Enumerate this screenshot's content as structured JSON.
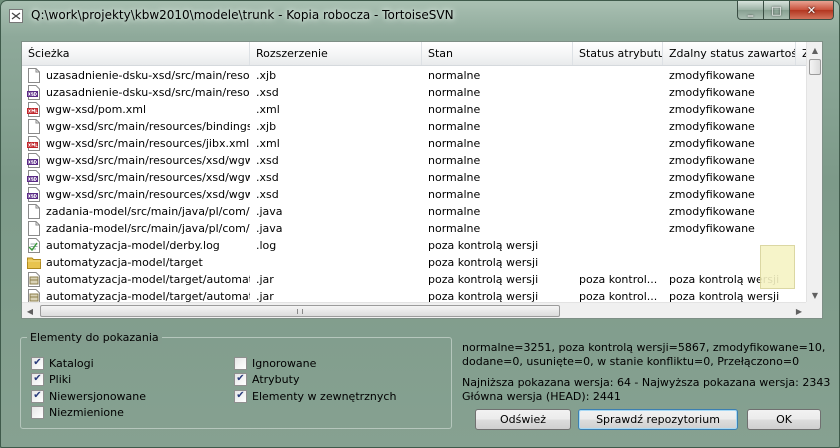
{
  "window": {
    "title": "Q:\\work\\projekty\\kbw2010\\modele\\trunk - Kopia robocza - TortoiseSVN",
    "minimize_glyph": "_",
    "maximize_glyph": "□",
    "close_glyph": "✕"
  },
  "list": {
    "columns": [
      "Ścieżka",
      "Rozszerzenie",
      "Stan",
      "Status atrybutu",
      "Zdalny status zawartości",
      "Z"
    ],
    "rows": [
      {
        "path": "uzasadnienie-dsku-xsd/src/main/reso...",
        "ext": ".xjb",
        "status": "normalne",
        "prop": "",
        "remote": "zmodyfikowane",
        "icon": "file-icon"
      },
      {
        "path": "uzasadnienie-dsku-xsd/src/main/reso...",
        "ext": ".xsd",
        "status": "normalne",
        "prop": "",
        "remote": "zmodyfikowane",
        "icon": "xsd-file-icon"
      },
      {
        "path": "wgw-xsd/pom.xml",
        "ext": ".xml",
        "status": "normalne",
        "prop": "",
        "remote": "zmodyfikowane",
        "icon": "xml-file-icon"
      },
      {
        "path": "wgw-xsd/src/main/resources/bindings.xjb",
        "ext": ".xjb",
        "status": "normalne",
        "prop": "",
        "remote": "zmodyfikowane",
        "icon": "file-icon"
      },
      {
        "path": "wgw-xsd/src/main/resources/jibx.xml",
        "ext": ".xml",
        "status": "normalne",
        "prop": "",
        "remote": "zmodyfikowane",
        "icon": "xml-file-icon"
      },
      {
        "path": "wgw-xsd/src/main/resources/xsd/wgw-...",
        "ext": ".xsd",
        "status": "normalne",
        "prop": "",
        "remote": "zmodyfikowane",
        "icon": "xsd-file-icon"
      },
      {
        "path": "wgw-xsd/src/main/resources/xsd/wgw-...",
        "ext": ".xsd",
        "status": "normalne",
        "prop": "",
        "remote": "zmodyfikowane",
        "icon": "xsd-file-icon"
      },
      {
        "path": "wgw-xsd/src/main/resources/xsd/wgw...",
        "ext": ".xsd",
        "status": "normalne",
        "prop": "",
        "remote": "zmodyfikowane",
        "icon": "xsd-file-icon"
      },
      {
        "path": "zadania-model/src/main/java/pl/com/pi...",
        "ext": ".java",
        "status": "normalne",
        "prop": "",
        "remote": "zmodyfikowane",
        "icon": "file-icon"
      },
      {
        "path": "zadania-model/src/main/java/pl/com/pi...",
        "ext": ".java",
        "status": "normalne",
        "prop": "",
        "remote": "zmodyfikowane",
        "icon": "file-icon"
      },
      {
        "path": "automatyzacja-model/derby.log",
        "ext": ".log",
        "status": "poza kontrolą wersji",
        "prop": "",
        "remote": "",
        "icon": "text-file-icon"
      },
      {
        "path": "automatyzacja-model/target",
        "ext": "",
        "status": "poza kontrolą wersji",
        "prop": "",
        "remote": "",
        "icon": "folder-icon"
      },
      {
        "path": "automatyzacja-model/target/automaty...",
        "ext": ".jar",
        "status": "poza kontrolą wersji",
        "prop": "poza kontrol...",
        "remote": "poza kontrolą wersji",
        "icon": "jar-file-icon"
      },
      {
        "path": "automatyzacja-model/target/automaty...",
        "ext": ".jar",
        "status": "poza kontrolą wersji",
        "prop": "poza kontrol...",
        "remote": "poza kontrolą wersji",
        "icon": "jar-file-icon"
      }
    ]
  },
  "filter": {
    "legend": "Elementy do pokazania",
    "checkboxes": [
      {
        "label": "Katalogi",
        "checked": true
      },
      {
        "label": "Pliki",
        "checked": true
      },
      {
        "label": "Niewersjonowane",
        "checked": true
      },
      {
        "label": "Niezmienione",
        "checked": false
      },
      {
        "label": "Ignorowane",
        "checked": false
      },
      {
        "label": "Atrybuty",
        "checked": true
      },
      {
        "label": "Elementy w zewnętrznych",
        "checked": true
      }
    ]
  },
  "stats": {
    "line1": "normalne=3251, poza kontrolą wersji=5867, zmodyfikowane=10,",
    "line2": "dodane=0, usunięte=0, w stanie konfliktu=0, Przełączono=0",
    "line3": "Najniższa pokazana wersja: 64 - Najwyższa pokazana wersja: 2343",
    "line4": "Główna wersja (HEAD): 2441"
  },
  "buttons": {
    "refresh": "Odśwież",
    "check_repo": "Sprawdź repozytorium",
    "ok": "OK"
  },
  "colors": {
    "aero_frame": "#7d9a89",
    "close_button": "#c8503a",
    "xml_icon_red": "#c0262b",
    "folder_yellow": "#e8c44f"
  }
}
